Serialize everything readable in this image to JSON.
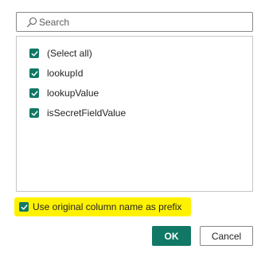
{
  "search": {
    "placeholder": "Search",
    "value": ""
  },
  "list": {
    "items": [
      {
        "label": "(Select all)",
        "checked": true
      },
      {
        "label": "lookupId",
        "checked": true
      },
      {
        "label": "lookupValue",
        "checked": true
      },
      {
        "label": "isSecretFieldValue",
        "checked": true
      }
    ]
  },
  "options": {
    "prefix_label": "Use original column name as prefix",
    "prefix_checked": true,
    "highlight_color": "#fff200"
  },
  "buttons": {
    "ok_label": "OK",
    "cancel_label": "Cancel"
  },
  "colors": {
    "accent": "#117865"
  }
}
